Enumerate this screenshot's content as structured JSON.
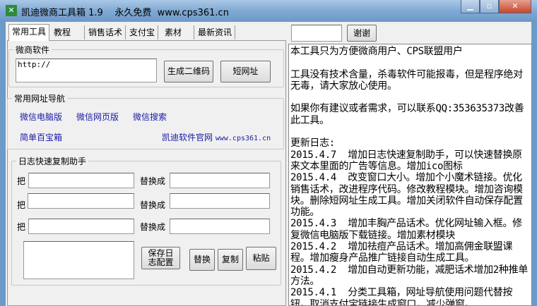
{
  "window": {
    "title": "凯迪微商工具箱 1.9    永久免费  www.cps361.cn",
    "icon": "app-icon",
    "minimize": "minimize-icon",
    "maximize": "maximize-icon",
    "close": "close-icon"
  },
  "tabs": [
    {
      "label": "常用工具"
    },
    {
      "label": "教程"
    },
    {
      "label": "销售话术"
    },
    {
      "label": "支付宝"
    },
    {
      "label": "素材"
    },
    {
      "label": "最新资讯"
    }
  ],
  "weishang": {
    "legend": "微商软件",
    "url_value": "http://",
    "qrcode_button": "生成二维码",
    "short_url_button": "短网址"
  },
  "nav": {
    "legend": "常用网址导航",
    "links": [
      "微信电脑版",
      "微信网页版",
      "微信搜索",
      "简单百宝箱"
    ],
    "official_site_label": "凯迪软件官网",
    "official_site_url": "www.cps361.cn"
  },
  "log_helper": {
    "legend": "日志快速复制助手",
    "from_label": "把",
    "to_label": "替换成",
    "rows": [
      {
        "from": "",
        "to": ""
      },
      {
        "from": "",
        "to": ""
      },
      {
        "from": "",
        "to": ""
      }
    ],
    "output": "",
    "save_button": "保存日志配置",
    "replace_button": "替换",
    "copy_button": "复制",
    "paste_button": "粘贴"
  },
  "thanks": {
    "input_value": "",
    "button": "谢谢"
  },
  "info_text": "本工具只为方便微商用户、CPS联盟用户\n\n工具没有技术含量，杀毒软件可能报毒，但是程序绝对无毒，请大家放心使用。\n\n如果你有建议或者需求，可以联系QQ:353635373改善此工具。\n\n更新日志:\n2015.4.7  增加日志快速复制助手，可以快速替换原来文本里面的广告等信息。增加ico图标\n2015.4.4  改变窗口大小。增加个小魔术链接。优化销售话术，改进程序代码。修改教程模块。增加咨询模块。删除短网址生成工具。增加关闭软件自动保存配置功能。\n2015.4.3  增加丰胸产品话术。优化网址输入框。修复微信电脑版下载链接。增加素材模块\n2015.4.2  增加祛痘产品话术。增加高佣金联盟课程。增加瘦身产品推广链接自动生成工具。\n2015.4.2  增加自动更新功能，减肥话术增加2种推单方法。\n2015.4.1  分类工具箱，网址导航使用问题代替按钮。取消支付宝链接生成窗口，减少弹窗。"
}
